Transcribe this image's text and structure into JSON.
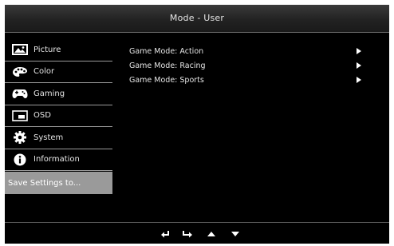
{
  "header": {
    "title": "Mode - User"
  },
  "menu": {
    "items": [
      {
        "label": "Picture",
        "icon": "picture-icon"
      },
      {
        "label": "Color",
        "icon": "palette-icon"
      },
      {
        "label": "Gaming",
        "icon": "gamepad-icon"
      },
      {
        "label": "OSD",
        "icon": "osd-window-icon"
      },
      {
        "label": "System",
        "icon": "gear-icon"
      },
      {
        "label": "Information",
        "icon": "info-icon"
      }
    ],
    "selected": {
      "label": "Save Settings to..."
    }
  },
  "content": {
    "rows": [
      {
        "label": "Game Mode: Action"
      },
      {
        "label": "Game Mode: Racing"
      },
      {
        "label": "Game Mode: Sports"
      }
    ]
  },
  "navigation": {
    "buttons": [
      "back-icon",
      "enter-icon",
      "up-icon",
      "down-icon"
    ]
  },
  "colors": {
    "background": "#000000",
    "selected": "#9a9a9a",
    "text": "#e6e6e6"
  }
}
